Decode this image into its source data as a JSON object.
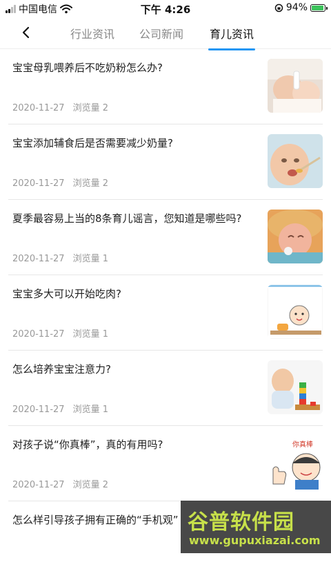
{
  "status_bar": {
    "carrier": "中国电信",
    "time": "下午 4:26",
    "battery": "94%",
    "battery_level": 0.94
  },
  "tabs": [
    {
      "label": "行业资讯",
      "active": false
    },
    {
      "label": "公司新闻",
      "active": false
    },
    {
      "label": "育儿资讯",
      "active": true
    }
  ],
  "articles": [
    {
      "title": "宝宝母乳喂养后不吃奶粉怎么办?",
      "date": "2020-11-27",
      "views": "浏览量 2",
      "thumb": "baby-bottle-photo"
    },
    {
      "title": "宝宝添加辅食后是否需要减少奶量?",
      "date": "2020-11-27",
      "views": "浏览量 2",
      "thumb": "baby-spoon-photo"
    },
    {
      "title": "夏季最容易上当的8条育儿谣言，您知道是哪些吗?",
      "date": "2020-11-27",
      "views": "浏览量 1",
      "thumb": "baby-hat-photo"
    },
    {
      "title": "宝宝多大可以开始吃肉?",
      "date": "2020-11-27",
      "views": "浏览量 1",
      "thumb": "baby-cartoon-drawing"
    },
    {
      "title": "怎么培养宝宝注意力?",
      "date": "2020-11-27",
      "views": "浏览量 1",
      "thumb": "baby-blocks-photo"
    },
    {
      "title": "对孩子说“你真棒”，真的有用吗?",
      "date": "2020-11-27",
      "views": "浏览量 2",
      "thumb": "thumbs-up-cartoon",
      "thumb_caption": "你真棒"
    },
    {
      "title": "怎么样引导孩子拥有正确的“手机观”",
      "date": "",
      "views": ""
    }
  ],
  "watermark": {
    "top": "谷普软件园",
    "bottom": "www.gupuxiazai.com"
  },
  "colors": {
    "accent": "#2196f3",
    "battery": "#3bc25a",
    "watermark": "#c7e04a"
  }
}
